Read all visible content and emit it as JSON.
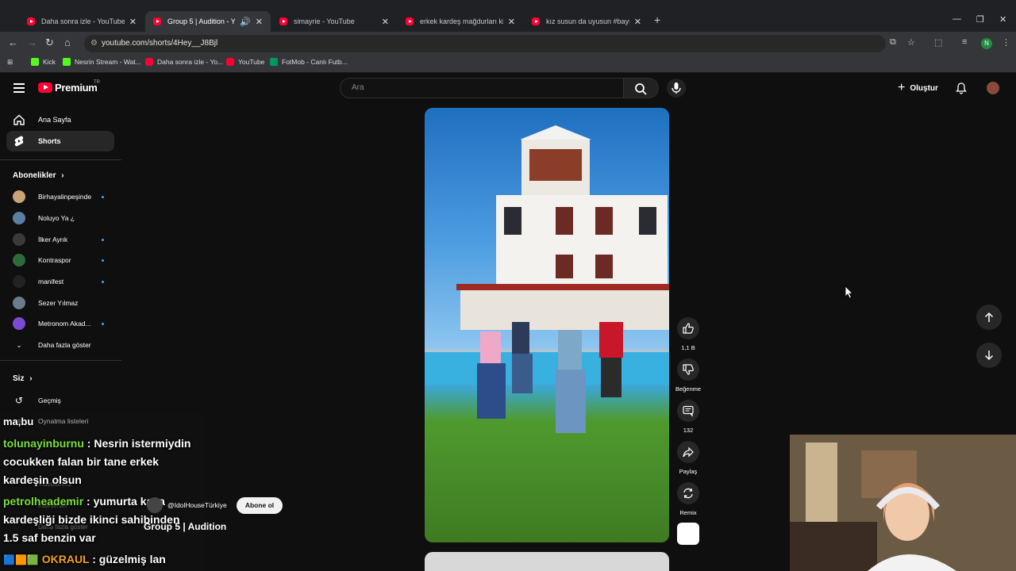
{
  "browser": {
    "tabs": [
      {
        "label": "Daha sonra izle - YouTube"
      },
      {
        "label": "Group 5 | Audition - YouTube"
      },
      {
        "label": "simayrie - YouTube"
      },
      {
        "label": "erkek kardeş mağdurları kişisel"
      },
      {
        "label": "kız susun da uyusun #bayram #"
      }
    ],
    "url": "youtube.com/shorts/4Hey__J8Bjl",
    "profile_initial": "N",
    "bookmarks": [
      {
        "label": "Kick"
      },
      {
        "label": "Nesrin Stream - Wat..."
      },
      {
        "label": "Daha sonra izle - Yo..."
      },
      {
        "label": "YouTube"
      },
      {
        "label": "FotMob - Canlı Futb..."
      }
    ]
  },
  "header": {
    "logo_text": "Premium",
    "region": "TR",
    "search_placeholder": "Ara",
    "create_label": "Oluştur"
  },
  "sidebar": {
    "home": "Ana Sayfa",
    "shorts": "Shorts",
    "subscriptions_title": "Abonelikler",
    "subscriptions": [
      {
        "name": "Birhayalinpeşinde",
        "color": "#c9a27a",
        "live": true
      },
      {
        "name": "Noluyo Ya ¿",
        "color": "#5a7fa0",
        "live": false
      },
      {
        "name": "İlker Ayrık",
        "color": "#3a3a3a",
        "live": true
      },
      {
        "name": "Kontraspor",
        "color": "#2f6b3a",
        "live": true
      },
      {
        "name": "manifest",
        "color": "#222222",
        "live": true
      },
      {
        "name": "Sezer Yılmaz",
        "color": "#6b7d8c",
        "live": false
      },
      {
        "name": "Metronom Akad...",
        "color": "#7b4bd6",
        "live": true
      }
    ],
    "show_more": "Daha fazla göster",
    "you_title": "Siz",
    "history": "Geçmiş",
    "playlists": "Oynatma listeleri",
    "videos": "Videolarınız",
    "downloads": "İndirilenler",
    "show_more_2": "Daha fazla göster"
  },
  "short": {
    "channel": "@IdolHouseTürkiye",
    "subscribe_label": "Abone ol",
    "title": "Group 5 | Audition",
    "likes": "1,1 B",
    "dislike_label": "Beğenme",
    "comments": "132",
    "share_label": "Paylaş",
    "remix_label": "Remix"
  },
  "chat": [
    {
      "user": "",
      "text": "ma,bu"
    },
    {
      "user": "tolunayinburnu",
      "text": " : Nesrin istermiydin"
    },
    {
      "user": "",
      "text": "cocukken falan bir tane erkek"
    },
    {
      "user": "",
      "text": "kardeşin olsun"
    },
    {
      "user": "petrolheademir",
      "text": " : yumurta kasa"
    },
    {
      "user": "",
      "text": "kardeşliği bizde ikinci sahibinden"
    },
    {
      "user": "",
      "text": "1.5 saf benzin var"
    },
    {
      "user": "OKRAUL",
      "text": " : güzelmiş lan"
    }
  ]
}
